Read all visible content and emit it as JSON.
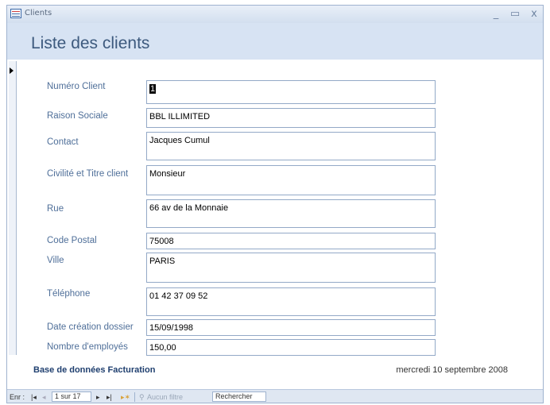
{
  "window": {
    "title": "Clients"
  },
  "header": {
    "title": "Liste des clients"
  },
  "form": {
    "fields": [
      {
        "label": "Numéro Client",
        "value": "1"
      },
      {
        "label": "Raison Sociale",
        "value": "BBL ILLIMITED"
      },
      {
        "label": "Contact",
        "value": "Jacques Cumul"
      },
      {
        "label": "Civilité et Titre client",
        "value": "Monsieur"
      },
      {
        "label": "Rue",
        "value": "66 av de la Monnaie"
      },
      {
        "label": "Code Postal",
        "value": "75008"
      },
      {
        "label": "Ville",
        "value": "PARIS"
      },
      {
        "label": "Téléphone",
        "value": "01 42 37 09 52"
      },
      {
        "label": "Date création dossier",
        "value": "15/09/1998"
      },
      {
        "label": "Nombre d'employés",
        "value": "150,00"
      }
    ]
  },
  "footer": {
    "db_label": "Base de données Facturation",
    "date": "mercredi 10 septembre 2008"
  },
  "navbar": {
    "enr_label": "Enr :",
    "record_pos": "1 sur 17",
    "filter_label": "Aucun filtre",
    "search_label": "Rechercher"
  },
  "icons": {
    "minimize": "minimize-icon",
    "maximize": "maximize-icon",
    "close": "close-icon",
    "nav_first": "first-record-icon",
    "nav_prev": "previous-record-icon",
    "nav_next": "next-record-icon",
    "nav_last": "last-record-icon",
    "nav_new": "new-record-icon",
    "filter": "filter-icon"
  }
}
